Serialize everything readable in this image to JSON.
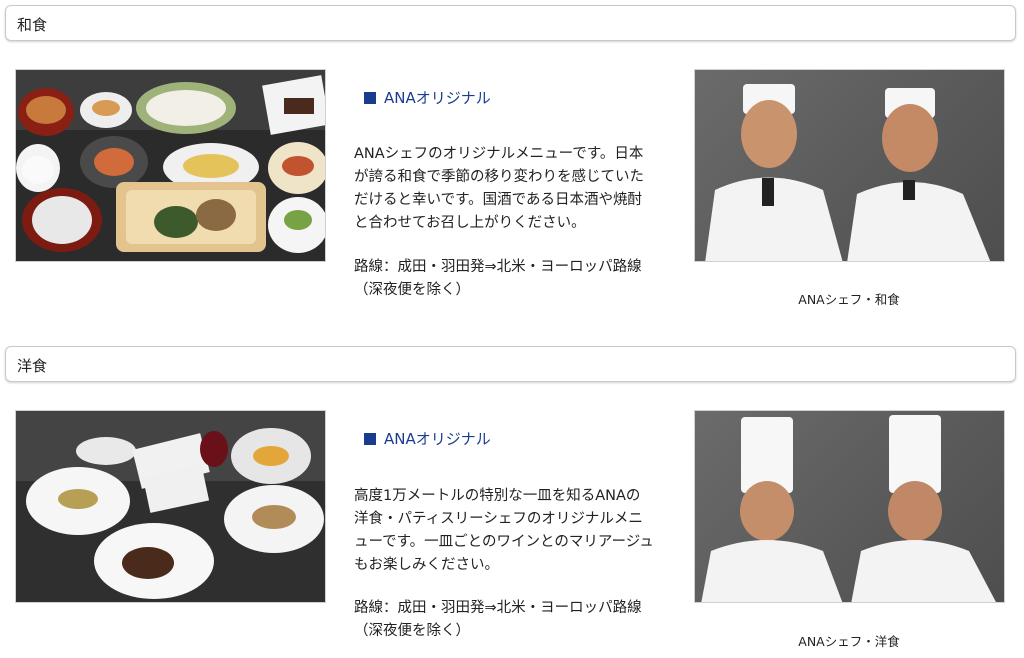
{
  "sections": [
    {
      "title": "和食",
      "tag_label": "ANAオリジナル",
      "description": "ANAシェフのオリジナルメニューです。日本が誇る和食で季節の移り変わりを感じていただけると幸いです。国酒である日本酒や焼酎と合わせてお召し上がりください。",
      "route_line1": "路線：成田・羽田発⇒北米・ヨーロッパ路線",
      "route_line2": "（深夜便を除く）",
      "chef_caption": "ANAシェフ・和食"
    },
    {
      "title": "洋食",
      "tag_label": "ANAオリジナル",
      "description": "高度1万メートルの特別な一皿を知るANAの洋食・パティスリーシェフのオリジナルメニューです。一皿ごとのワインとのマリアージュもお楽しみください。",
      "route_line1": "路線：成田・羽田発⇒北米・ヨーロッパ路線",
      "route_line2": "（深夜便を除く）",
      "chef_caption": "ANAシェフ・洋食"
    }
  ],
  "colors": {
    "accent": "#1a3c8f",
    "border": "#c9c9c9"
  }
}
